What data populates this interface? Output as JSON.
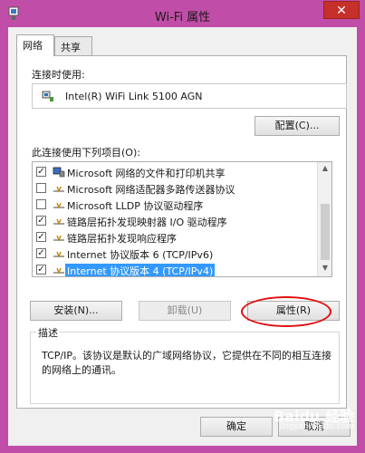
{
  "window": {
    "title": "Wi-Fi 属性",
    "close_glyph": "✕"
  },
  "tabs": [
    {
      "label": "网络",
      "active": true
    },
    {
      "label": "共享",
      "active": false
    }
  ],
  "connect_using": {
    "label": "连接时使用:",
    "adapter": "Intel(R) WiFi Link 5100 AGN",
    "configure_label": "配置(C)..."
  },
  "items_section": {
    "label": "此连接使用下列项目(O):",
    "items": [
      {
        "label": "Microsoft 网络的文件和打印机共享",
        "checked": true,
        "icon": "network-share-icon",
        "selected": false
      },
      {
        "label": "Microsoft 网络适配器多路传送器协议",
        "checked": false,
        "icon": "protocol-icon",
        "selected": false
      },
      {
        "label": "Microsoft LLDP 协议驱动程序",
        "checked": false,
        "icon": "protocol-icon",
        "selected": false
      },
      {
        "label": "链路层拓扑发现映射器 I/O 驱动程序",
        "checked": true,
        "icon": "protocol-icon",
        "selected": false
      },
      {
        "label": "链路层拓扑发现响应程序",
        "checked": true,
        "icon": "protocol-icon",
        "selected": false
      },
      {
        "label": "Internet 协议版本 6 (TCP/IPv6)",
        "checked": true,
        "icon": "protocol-icon",
        "selected": false
      },
      {
        "label": "Internet 协议版本 4 (TCP/IPv4)",
        "checked": true,
        "icon": "protocol-icon",
        "selected": true
      }
    ],
    "check_glyph": "✓",
    "scroll_up_glyph": "▲",
    "scroll_down_glyph": "▼"
  },
  "actions": {
    "install": "安装(N)...",
    "uninstall": "卸载(U)",
    "properties": "属性(R)"
  },
  "description": {
    "title": "描述",
    "text": "TCP/IP。该协议是默认的广域网络协议，它提供在不同的相互连接的网络上的通讯。"
  },
  "footer": {
    "ok": "确定",
    "cancel": "取消"
  },
  "watermark": {
    "text": "Baidu 经验",
    "sub": "jingyan.baidu.com"
  },
  "colors": {
    "frame": "#c04ea8",
    "close": "#c7302a",
    "selection": "#3399ff",
    "annotation": "#e01010"
  }
}
